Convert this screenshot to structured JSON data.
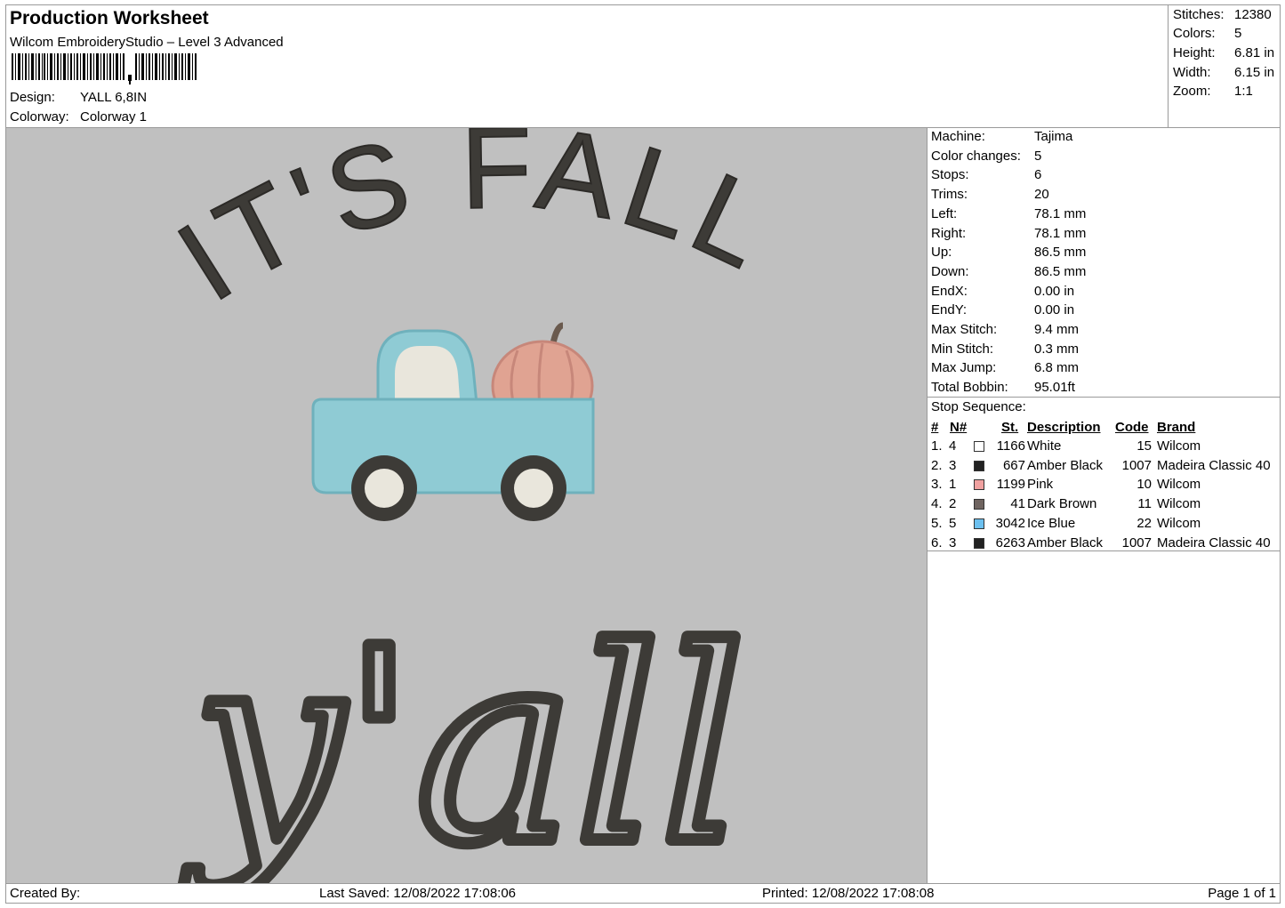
{
  "header": {
    "title": "Production Worksheet",
    "software": "Wilcom EmbroideryStudio – Level 3 Advanced",
    "design_label": "Design:",
    "design_value": "YALL 6,8IN",
    "colorway_label": "Colorway:",
    "colorway_value": "Colorway 1"
  },
  "summary": {
    "stitches_label": "Stitches:",
    "stitches_value": "12380",
    "colors_label": "Colors:",
    "colors_value": "5",
    "height_label": "Height:",
    "height_value": "6.81 in",
    "width_label": "Width:",
    "width_value": "6.15 in",
    "zoom_label": "Zoom:",
    "zoom_value": "1:1"
  },
  "design_text": {
    "line1": "IT'S FALL",
    "line2": "y'all"
  },
  "colors": {
    "canvas_bg": "#c0c0c0",
    "thread_black": "#3d3b37",
    "ice_blue": "#8fcbd4",
    "pink": "#e0a392",
    "white": "#e9e6dc",
    "brown": "#6a5a4e"
  },
  "machine_info": [
    {
      "label": "Machine:",
      "value": "Tajima"
    },
    {
      "label": "Color changes:",
      "value": "5"
    },
    {
      "label": "Stops:",
      "value": "6"
    },
    {
      "label": "Trims:",
      "value": "20"
    },
    {
      "label": "Left:",
      "value": "78.1 mm"
    },
    {
      "label": "Right:",
      "value": "78.1 mm"
    },
    {
      "label": "Up:",
      "value": "86.5 mm"
    },
    {
      "label": "Down:",
      "value": "86.5 mm"
    },
    {
      "label": "EndX:",
      "value": "0.00 in"
    },
    {
      "label": "EndY:",
      "value": "0.00 in"
    },
    {
      "label": "Max Stitch:",
      "value": "9.4 mm"
    },
    {
      "label": "Min Stitch:",
      "value": "0.3 mm"
    },
    {
      "label": "Max Jump:",
      "value": "6.8 mm"
    },
    {
      "label": "Total Bobbin:",
      "value": "95.01ft"
    }
  ],
  "stop_sequence": {
    "title": "Stop Sequence:",
    "columns": {
      "idx": "#",
      "n": "N#",
      "st": "St.",
      "desc": "Description",
      "code": "Code",
      "brand": "Brand"
    },
    "rows": [
      {
        "idx": "1.",
        "n": "4",
        "swatch": "#ffffff",
        "st": "1166",
        "desc": "White",
        "code": "15",
        "brand": "Wilcom"
      },
      {
        "idx": "2.",
        "n": "3",
        "swatch": "#222222",
        "st": "667",
        "desc": "Amber Black",
        "code": "1007",
        "brand": "Madeira Classic 40"
      },
      {
        "idx": "3.",
        "n": "1",
        "swatch": "#f0a1a0",
        "st": "1199",
        "desc": "Pink",
        "code": "10",
        "brand": "Wilcom"
      },
      {
        "idx": "4.",
        "n": "2",
        "swatch": "#6f6460",
        "st": "41",
        "desc": "Dark Brown",
        "code": "11",
        "brand": "Wilcom"
      },
      {
        "idx": "5.",
        "n": "5",
        "swatch": "#6cc0ef",
        "st": "3042",
        "desc": "Ice Blue",
        "code": "22",
        "brand": "Wilcom"
      },
      {
        "idx": "6.",
        "n": "3",
        "swatch": "#222222",
        "st": "6263",
        "desc": "Amber Black",
        "code": "1007",
        "brand": "Madeira Classic 40"
      }
    ]
  },
  "footer": {
    "created_by": "Created By:",
    "last_saved": "Last Saved: 12/08/2022 17:08:06",
    "printed": "Printed: 12/08/2022 17:08:08",
    "page": "Page 1 of 1"
  }
}
